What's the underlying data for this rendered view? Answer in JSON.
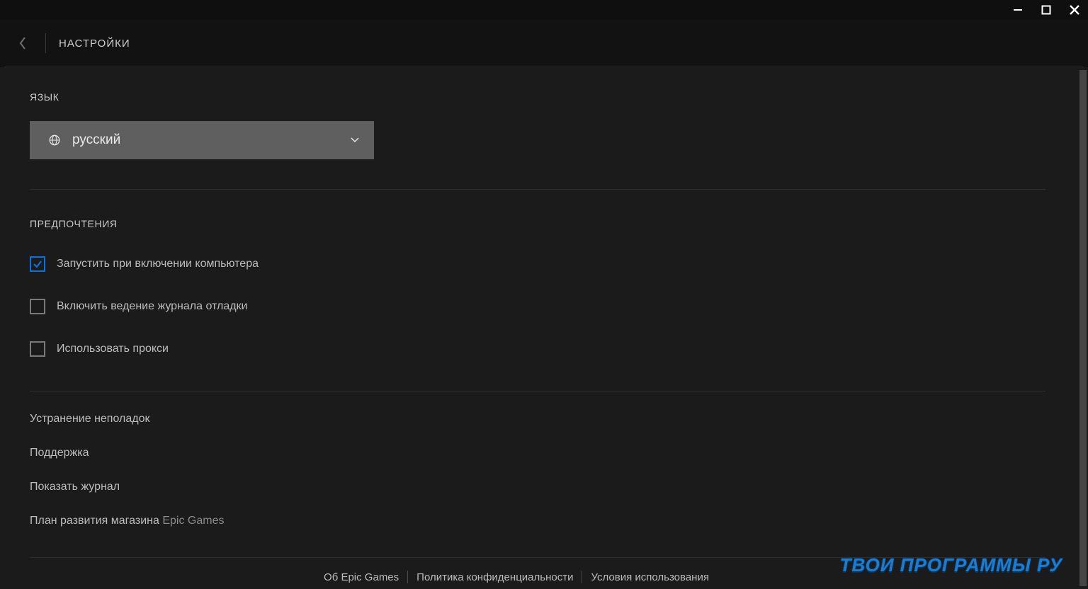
{
  "window_controls": {
    "minimize": "minimize",
    "maximize": "maximize",
    "close": "close"
  },
  "header": {
    "title": "НАСТРОЙКИ"
  },
  "language": {
    "heading": "ЯЗЫК",
    "selected": "русский"
  },
  "preferences": {
    "heading": "ПРЕДПОЧТЕНИЯ",
    "items": [
      {
        "label": "Запустить при включении компьютера",
        "checked": true
      },
      {
        "label": "Включить ведение журнала отладки",
        "checked": false
      },
      {
        "label": "Использовать прокси",
        "checked": false
      }
    ]
  },
  "links": {
    "troubleshoot": "Устранение неполадок",
    "support": "Поддержка",
    "show_log": "Показать журнал",
    "roadmap_prefix": "План развития магазина ",
    "roadmap_suffix": "Epic Games"
  },
  "footer": {
    "about": "Об Epic Games",
    "privacy": "Политика конфиденциальности",
    "terms": "Условия использования"
  },
  "watermark": "ТВОИ ПРОГРАММЫ РУ"
}
